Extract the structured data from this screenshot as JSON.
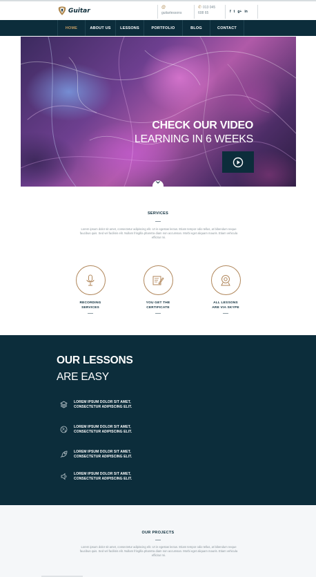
{
  "brand": {
    "name": "Guitar"
  },
  "topbar": {
    "email": "guitarlessons",
    "phone_line1": "013 045",
    "phone_line2": "608 65",
    "social": [
      {
        "name": "facebook-icon",
        "glyph": "f"
      },
      {
        "name": "twitter-icon",
        "glyph": "t"
      },
      {
        "name": "google-plus-icon",
        "glyph": "g+"
      },
      {
        "name": "linkedin-icon",
        "glyph": "in"
      }
    ]
  },
  "nav": {
    "items": [
      "HOME",
      "ABOUT US",
      "LESSONS",
      "PORTFOLIO",
      "BLOG",
      "CONTACT"
    ],
    "active": "HOME"
  },
  "hero": {
    "title": "CHECK OUR VIDEO",
    "subtitle": "LEARNING IN 6 WEEKS"
  },
  "services": {
    "title": "SERVICES",
    "lorem": "Lorem ipsum dolor sit amet, consectetur adipiscing elit. Ut in egestas lectus. Etiam tempor odio tellus, at bibendum neque faucibus quis. Sed vel facilisis elit. Nullam fringilla pharetra diam non accumsan. Morbi eget aliquam mauris. Etiam vehicula efficitur mi.",
    "items": [
      {
        "icon": "microphone-icon",
        "line1": "RECORDING",
        "line2": "SERVICES"
      },
      {
        "icon": "certificate-icon",
        "line1": "YOU GET THE",
        "line2": "CERTIFICATE"
      },
      {
        "icon": "webcam-icon",
        "line1": "ALL LESSONS",
        "line2": "ARE VIA SKYPE"
      }
    ]
  },
  "lessons": {
    "title": "OUR LESSONS",
    "subtitle": "ARE EASY",
    "items": [
      {
        "icon": "layers-icon",
        "line1": "LOREM IPSUM DOLOR SIT AMET,",
        "line2": "CONSECTETUR ADIPISCING ELIT."
      },
      {
        "icon": "globe-icon",
        "line1": "LOREM IPSUM DOLOR SIT AMET,",
        "line2": "CONSECTETUR ADIPISCING ELIT."
      },
      {
        "icon": "rocket-icon",
        "line1": "LOREM IPSUM DOLOR SIT AMET,",
        "line2": "CONSECTETUR ADIPISCING ELIT."
      },
      {
        "icon": "speaker-icon",
        "line1": "LOREM IPSUM DOLOR SIT AMET,",
        "line2": "CONSECTETUR ADIPISCING ELIT."
      }
    ]
  },
  "projects": {
    "title": "OUR PROJECTS",
    "lorem": "Lorem ipsum dolor sit amet, consectetur adipiscing elit. Ut in egestas lectus. Etiam tempor odio tellus, at bibendum neque faucibus quis. Sed vel facilisis elit. Nullam fringilla pharetra diam non accumsan. Morbi eget aliquam mauris. Etiam vehicula efficitur mi."
  },
  "colors": {
    "navy": "#0c2d3b",
    "accent": "#c19b63"
  }
}
